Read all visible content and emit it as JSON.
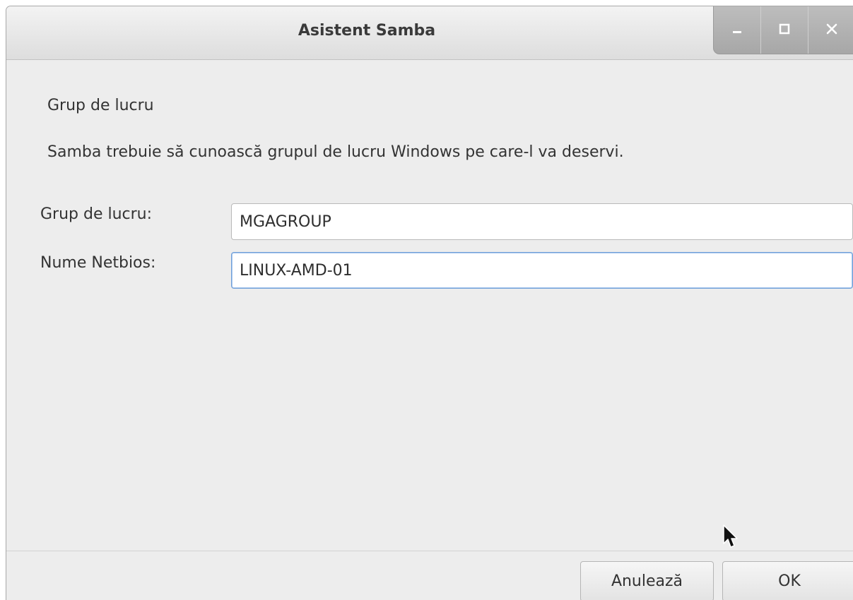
{
  "window": {
    "title": "Asistent Samba",
    "controls": {
      "minimize": "minimize-icon",
      "maximize": "maximize-icon",
      "close": "close-icon"
    }
  },
  "page": {
    "section_title": "Grup de lucru",
    "description": "Samba trebuie să cunoască grupul de lucru Windows pe care-l va deservi."
  },
  "form": {
    "workgroup": {
      "label": "Grup de lucru:",
      "value": "MGAGROUP"
    },
    "netbios": {
      "label": "Nume Netbios:",
      "value": "LINUX-AMD-01"
    }
  },
  "buttons": {
    "cancel_label": "Anulează",
    "ok_label": "OK"
  },
  "colors": {
    "focus_border": "#6f9fd8",
    "window_bg": "#ededed"
  }
}
